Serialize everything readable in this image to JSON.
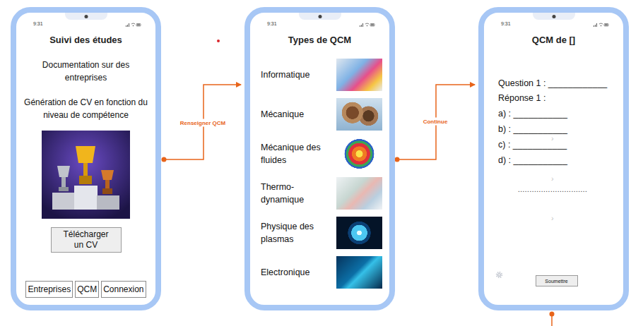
{
  "home_screen": {
    "time": "9:31",
    "title": "Suivi des études",
    "paragraphs": [
      "Documentation sur des entreprises",
      "Génération de CV en fonction du niveau de compétence"
    ],
    "download_button": "Télécharger un CV",
    "nav": [
      {
        "label": "Entreprises"
      },
      {
        "label": "QCM"
      },
      {
        "label": "Connexion"
      }
    ]
  },
  "qcm_types_screen": {
    "time": "9:31",
    "title": "Types de QCM",
    "types": [
      {
        "label": "Informatique"
      },
      {
        "label": "Mécanique"
      },
      {
        "label": "Mécanique des fluides"
      },
      {
        "label": "Thermo-dynamique"
      },
      {
        "label": "Physique des plasmas"
      },
      {
        "label": "Electronique"
      }
    ]
  },
  "qcm_screen": {
    "time": "9:31",
    "title": "QCM de []",
    "question": "Question 1 : ____________",
    "answer_label": "Réponse 1 :",
    "options": [
      "a) : ___________",
      "b) : ___________",
      "c) : ___________",
      "d) : ___________"
    ],
    "chevrons": [
      "›",
      "›",
      "›"
    ],
    "dotted": "..............................",
    "submit_button": "Soumettre"
  },
  "connectors": [
    {
      "label": "Renseigner QCM"
    },
    {
      "label": "Continue"
    }
  ]
}
